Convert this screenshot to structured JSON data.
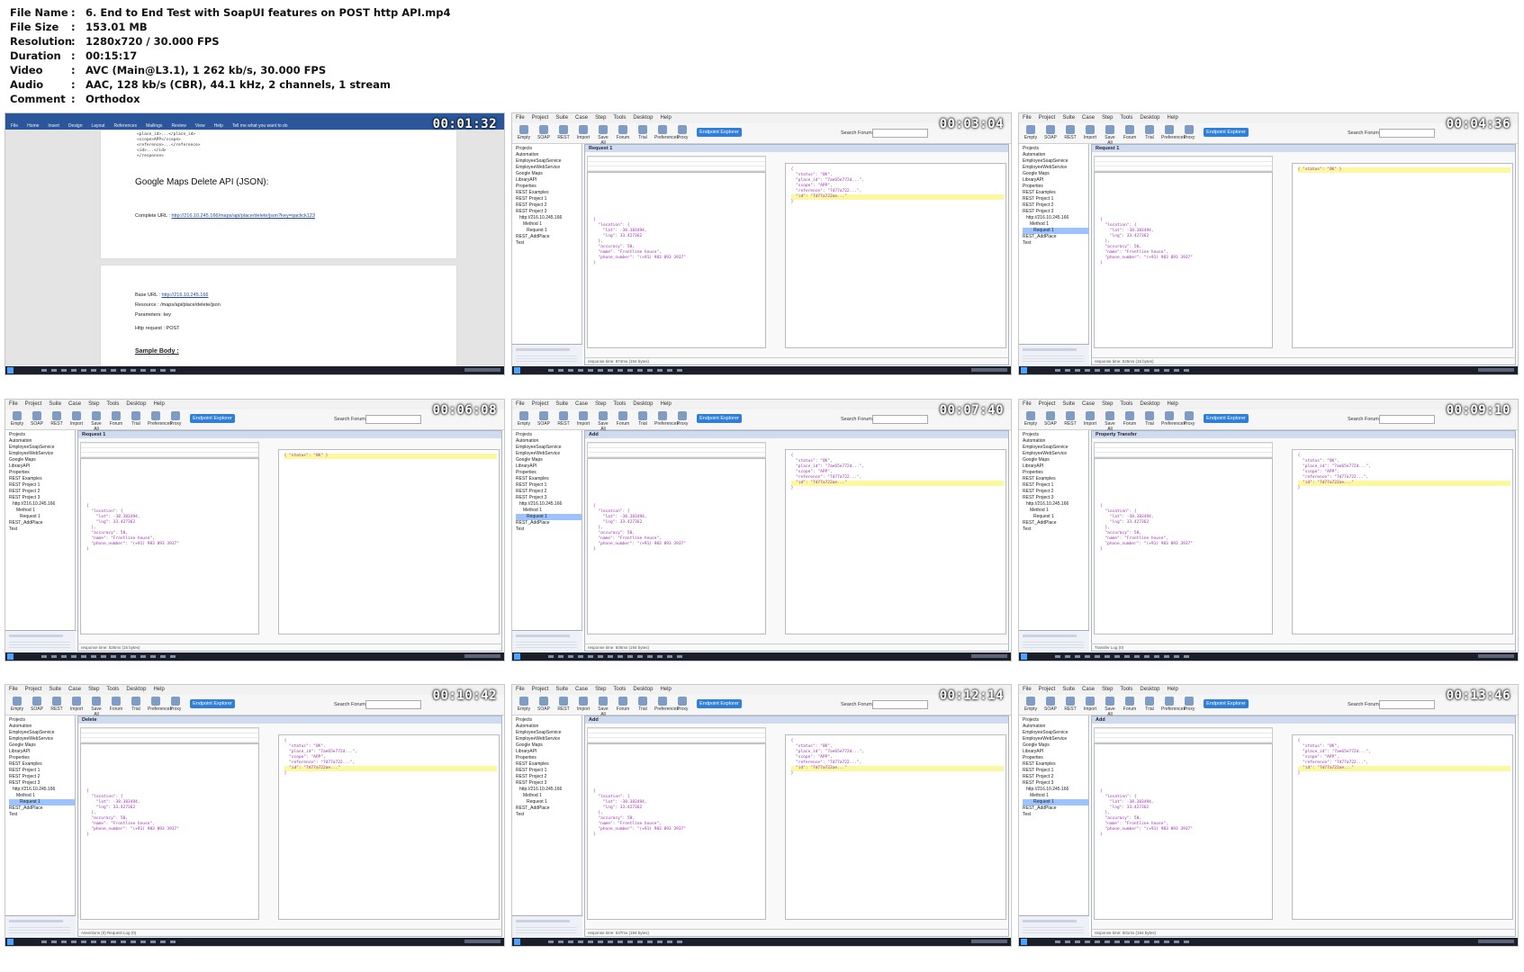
{
  "info": [
    {
      "key": "File Name",
      "value": "6. End to End Test with SoapUI features on POST http API.mp4"
    },
    {
      "key": "File Size",
      "value": "153.01 MB"
    },
    {
      "key": "Resolution",
      "value": "1280x720 / 30.000 FPS"
    },
    {
      "key": "Duration",
      "value": "00:15:17"
    },
    {
      "key": "Video",
      "value": "AVC (Main@L3.1), 1 262 kb/s, 30.000 FPS"
    },
    {
      "key": "Audio",
      "value": "AAC, 128 kb/s (CBR), 44.1 kHz, 2 channels, 1 stream"
    },
    {
      "key": "Comment",
      "value": "Orthodox"
    }
  ],
  "colon": ":",
  "thumbs": [
    {
      "timestamp": "00:01:32",
      "app": "word",
      "doc_heading": "Google Maps Delete API (JSON):",
      "complete_url_label": "Complete URL :",
      "complete_url": "http://216.10.245.166/maps/api/place/delete/json?key=qaclick123",
      "base_url_label": "Base URL :",
      "base_url": "http://216.10.245.166",
      "resource_label": "Resource :",
      "resource": "/maps/api/place/delete/json",
      "parameters_label": "Parameters:",
      "parameters": "key",
      "http_request_label": "Http request :",
      "http_request": "POST",
      "sample_body_label": "Sample Body :"
    },
    {
      "timestamp": "00:03:04",
      "app": "soapui",
      "panel": "Request 1",
      "status": "response time: 874ms (194 bytes)"
    },
    {
      "timestamp": "00:04:36",
      "app": "soapui",
      "panel": "Request 1",
      "status": "response time: 525ms (15 bytes)"
    },
    {
      "timestamp": "00:06:08",
      "app": "soapui",
      "panel": "Request 1",
      "status": "response time: 526ms (15 bytes)"
    },
    {
      "timestamp": "00:07:40",
      "app": "soapui",
      "panel": "Add",
      "status": "response time: 505ms (194 bytes)"
    },
    {
      "timestamp": "00:09:10",
      "app": "soapui",
      "panel": "Property Transfer",
      "status": "Transfer Log (0)"
    },
    {
      "timestamp": "00:10:42",
      "app": "soapui",
      "panel": "Delete",
      "status": "Assertions (0)  Request Log (0)"
    },
    {
      "timestamp": "00:12:14",
      "app": "soapui",
      "panel": "Add",
      "status": "response time: 537ms (194 bytes)"
    },
    {
      "timestamp": "00:13:46",
      "app": "soapui",
      "panel": "Add",
      "status": "response time: 501ms (194 bytes)"
    }
  ],
  "soapui": {
    "menu": [
      "File",
      "Project",
      "Suite",
      "Case",
      "Step",
      "Tools",
      "Desktop",
      "Help"
    ],
    "toolbar": [
      "Empty",
      "SOAP",
      "REST",
      "Import",
      "Save All",
      "Forum",
      "Trial",
      "Preferences",
      "Proxy"
    ],
    "endpoint_explorer": "Endpoint Explorer",
    "search_forum": "Search Forum",
    "tree": [
      "Projects",
      "Automation",
      "EmployeeSoapService",
      "EmployeeWebService",
      "Google Maps",
      "LibraryAPI",
      "Properties",
      "REST Examples",
      "REST Project 1",
      "REST Project 2",
      "REST Project 3",
      "http://216.10.245.166",
      "Method 1",
      "Request 1",
      "REST_AddPlace",
      "Test"
    ]
  },
  "word": {
    "tabs": [
      "File",
      "Home",
      "Insert",
      "Design",
      "Layout",
      "References",
      "Mailings",
      "Review",
      "View",
      "Help",
      "Tell me what you want to do"
    ]
  },
  "colors": {
    "accent": "#2f7fd8",
    "word": "#2b579a",
    "json": "#a12db8",
    "highlight": "#fbf8a0"
  }
}
